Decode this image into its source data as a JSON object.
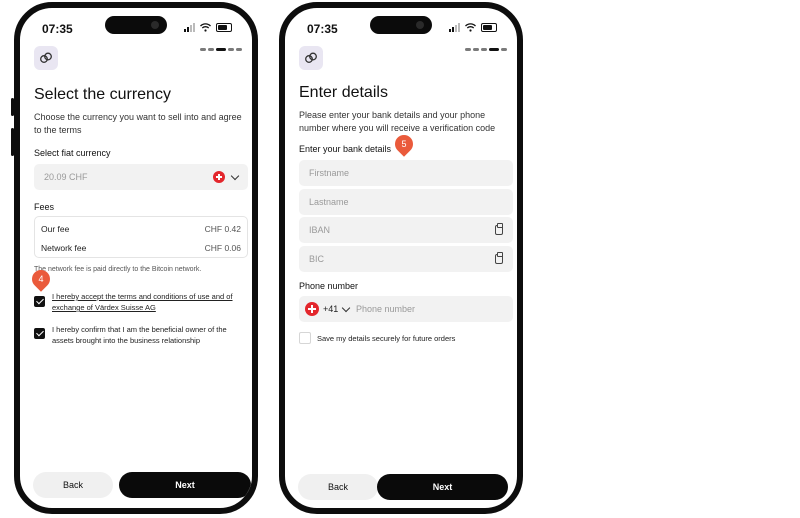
{
  "status_bar": {
    "time": "07:35"
  },
  "screen1": {
    "title": "Select the currency",
    "subtitle": "Choose the currency you want to sell into and agree to the terms",
    "fiat_label": "Select fiat currency",
    "fiat_value": "20.09 CHF",
    "fees_label": "Fees",
    "fees": [
      {
        "name": "Our fee",
        "value": "CHF 0.42"
      },
      {
        "name": "Network fee",
        "value": "CHF 0.06"
      }
    ],
    "network_note": "The network fee is paid directly to the Bitcoin network.",
    "terms_text": "I hereby accept the terms and conditions of use and of exchange of Värdex Suisse AG",
    "owner_text": "I hereby confirm that I am the beneficial owner of the assets brought into the business relationship",
    "annotation": "4",
    "back_label": "Back",
    "next_label": "Next"
  },
  "screen2": {
    "title": "Enter details",
    "subtitle": "Please enter your bank details and your phone number where you will receive a verification code",
    "bank_label": "Enter your bank details",
    "annotation": "5",
    "firstname_placeholder": "Firstname",
    "lastname_placeholder": "Lastname",
    "iban_placeholder": "IBAN",
    "bic_placeholder": "BIC",
    "phone_label": "Phone number",
    "country_code": "+41",
    "phone_placeholder": "Phone number",
    "save_text": "Save my details securely for future orders",
    "back_label": "Back",
    "next_label": "Next"
  },
  "colors": {
    "accent_pin": "#ea5a3b",
    "swiss_red": "#e3262c",
    "primary_button": "#0a0a0a"
  },
  "icons": [
    "app-logo-icon",
    "swiss-flag-icon",
    "chevron-down-icon",
    "clipboard-icon",
    "checkbox-checked-icon"
  ]
}
